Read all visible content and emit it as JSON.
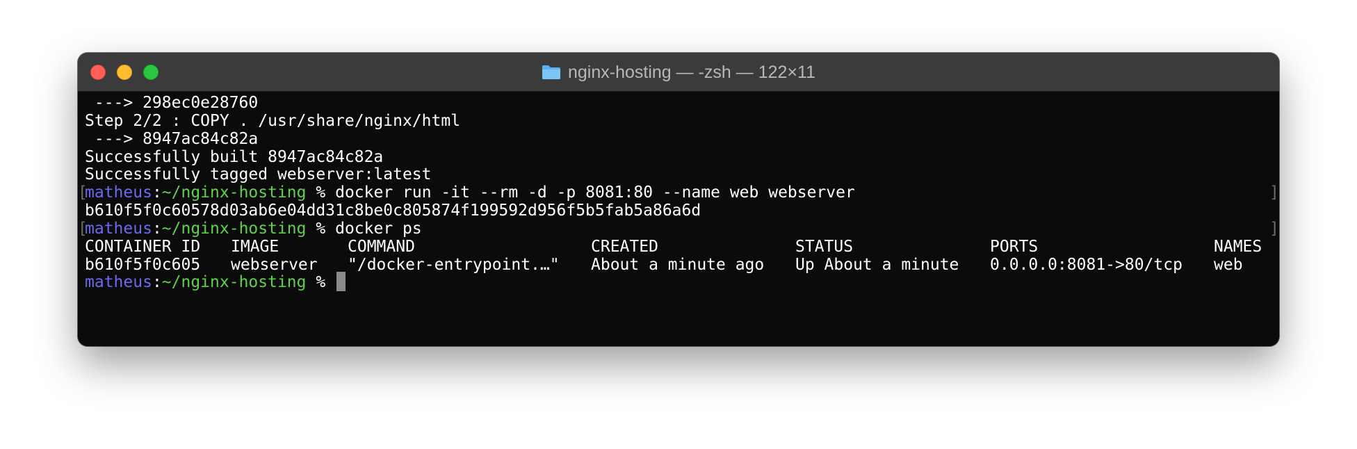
{
  "window": {
    "title": "nginx-hosting — -zsh — 122×11"
  },
  "prompt": {
    "user": "matheus",
    "separator": ":",
    "path": "~/nginx-hosting",
    "symbol": "%"
  },
  "lines": [
    " ---> 298ec0e28760",
    "Step 2/2 : COPY . /usr/share/nginx/html",
    " ---> 8947ac84c82a",
    "Successfully built 8947ac84c82a",
    "Successfully tagged webserver:latest"
  ],
  "commands": {
    "run": "docker run -it --rm -d -p 8081:80 --name web webserver",
    "run_output": "b610f5f0c60578d03ab6e04dd31c8be0c805874f199592d956f5b5fab5a86a6d",
    "ps": "docker ps"
  },
  "table": {
    "headers": [
      "CONTAINER ID",
      "IMAGE",
      "COMMAND",
      "CREATED",
      "STATUS",
      "PORTS",
      "NAMES"
    ],
    "rows": [
      [
        "b610f5f0c605",
        "webserver",
        "\"/docker-entrypoint.…\"",
        "About a minute ago",
        "Up About a minute",
        "0.0.0.0:8081->80/tcp",
        "web"
      ]
    ]
  },
  "colors": {
    "user": "#6b69f0",
    "path": "#5fd24a",
    "background": "#0b0b0b",
    "titlebar": "#3b3b3b"
  }
}
